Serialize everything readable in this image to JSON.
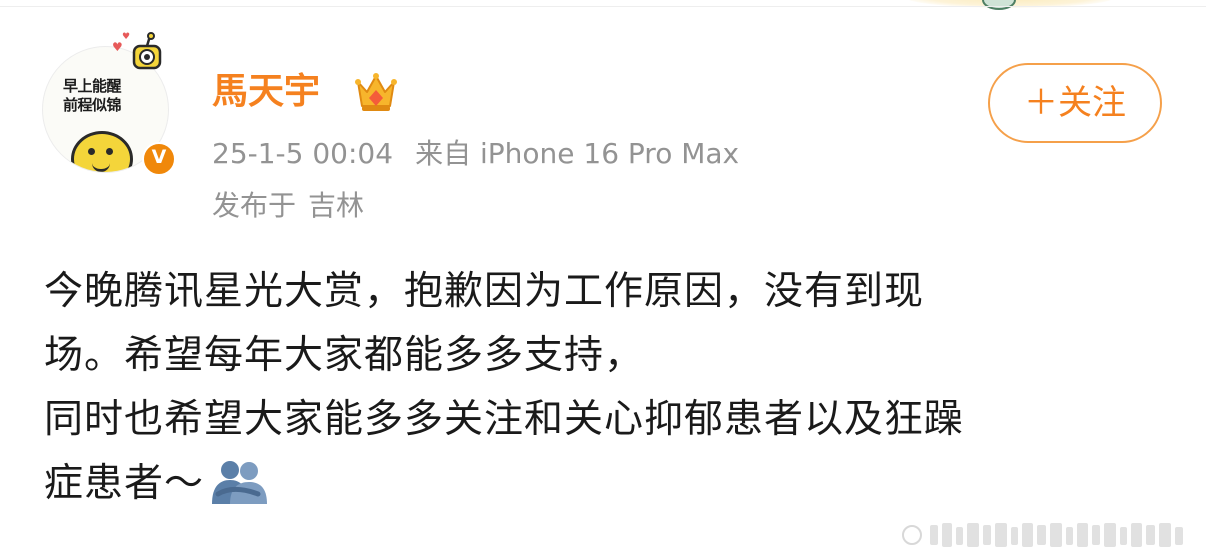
{
  "avatar": {
    "text": "早上能醒\n前程似锦",
    "verified_mark": "V",
    "icon": "cartoon-avatar"
  },
  "user": {
    "name": "馬天宇",
    "badge_icon": "crown-icon",
    "name_color": "#f5811f"
  },
  "post": {
    "date": "25-1-5 00:04",
    "source": "来自 iPhone 16 Pro Max",
    "location_prefix": "发布于",
    "location": "吉林",
    "lines": [
      "今晚腾讯星光大赏，抱歉因为工作原因，没有到现",
      "场。希望每年大家都能多多支持，",
      "同时也希望大家能多多关注和关心抑郁患者以及狂躁",
      "症患者～"
    ],
    "trailing_emoji": "hug-emoji"
  },
  "actions": {
    "follow_label": "＋关注",
    "accent": "#f5a04a"
  },
  "colors": {
    "meta_text": "#939393",
    "body_text": "#1a1a1a"
  }
}
